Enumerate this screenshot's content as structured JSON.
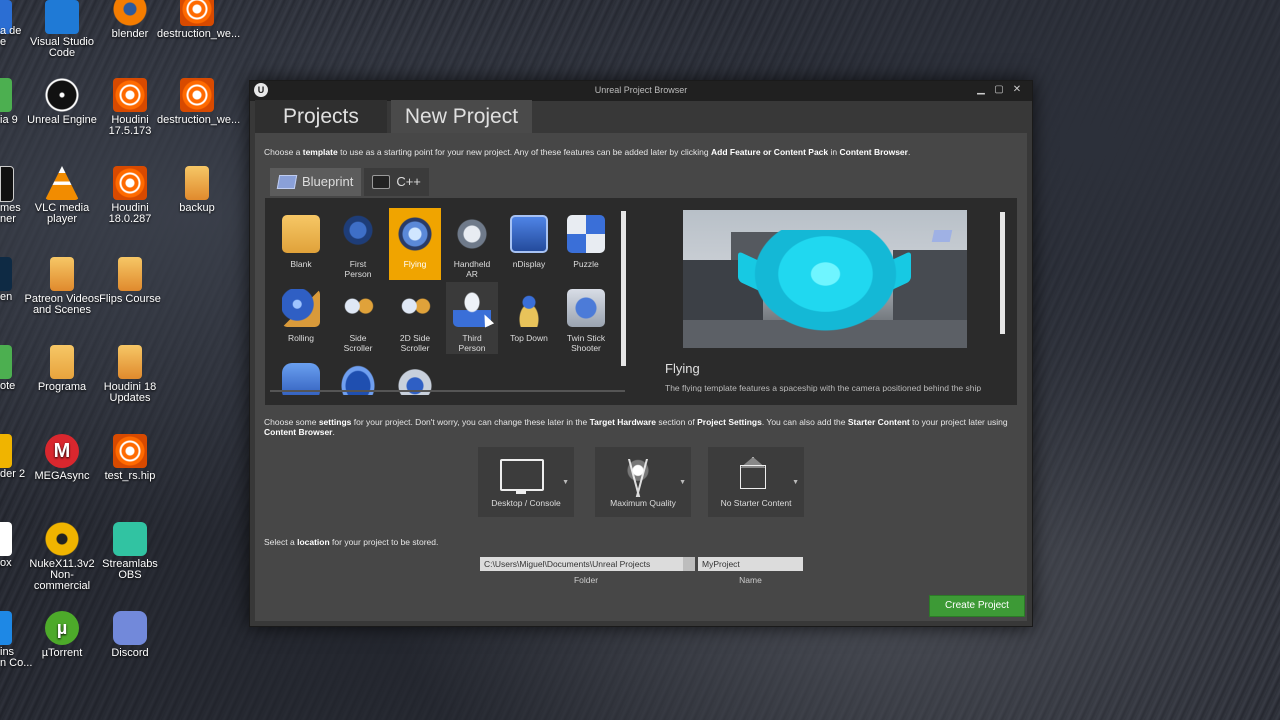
{
  "desktop": {
    "icons": [
      {
        "label": "Visual Studio\nCode",
        "icon": "vscode-icon",
        "color": "#1f7ad6"
      },
      {
        "label": "blender",
        "icon": "blender-icon",
        "color": "#f57d00"
      },
      {
        "label": "destruction_we...",
        "icon": "houdini-icon",
        "color": "#ff6a00"
      },
      {
        "label": "Unreal Engine",
        "icon": "unreal-engine-icon",
        "color": "#1b1b1b"
      },
      {
        "label": "Houdini 17.5.173",
        "icon": "houdini-icon",
        "color": "#ff6a00"
      },
      {
        "label": "destruction_we...",
        "icon": "houdini-icon",
        "color": "#ff6a00"
      },
      {
        "label": "VLC media player",
        "icon": "vlc-icon",
        "color": "#f28c00"
      },
      {
        "label": "Houdini 18.0.287",
        "icon": "houdini-icon",
        "color": "#ff6a00"
      },
      {
        "label": "backup",
        "icon": "folder-houdini-icon",
        "color": "#f2a93a"
      },
      {
        "label": "Patreon Videos\nand Scenes",
        "icon": "folder-houdini-icon",
        "color": "#f2a93a"
      },
      {
        "label": "Flips Course",
        "icon": "folder-houdini-icon",
        "color": "#f2a93a"
      },
      {
        "label": "Programa",
        "icon": "folder-icon",
        "color": "#f2b94a"
      },
      {
        "label": "Houdini 18\nUpdates",
        "icon": "folder-houdini-icon",
        "color": "#f2a93a"
      },
      {
        "label": "MEGAsync",
        "icon": "mega-icon",
        "color": "#d9272e"
      },
      {
        "label": "test_rs.hip",
        "icon": "houdini-icon",
        "color": "#ff6a00"
      },
      {
        "label": "NukeX11.3v2\nNon-commercial",
        "icon": "nuke-icon",
        "color": "#f0b400"
      },
      {
        "label": "Streamlabs OBS",
        "icon": "streamlabs-icon",
        "color": "#31c3a2"
      },
      {
        "label": "µTorrent",
        "icon": "utorrent-icon",
        "color": "#4daa2a"
      },
      {
        "label": "Discord",
        "icon": "discord-icon",
        "color": "#7289da"
      }
    ],
    "partial_labels": [
      "a de\ne",
      "ia 9",
      "mes\nner",
      "en",
      "ote",
      "der 2",
      "ox",
      "ins\nn Co..."
    ]
  },
  "window": {
    "title": "Unreal Project Browser",
    "controls": {
      "minimize": "▁",
      "maximize": "▢",
      "close": "✕"
    },
    "tabs": [
      {
        "label": "Projects",
        "active": false
      },
      {
        "label": "New Project",
        "active": true
      }
    ],
    "intro": {
      "p1": "Choose a ",
      "b1": "template",
      "p2": " to use as a starting point for your new project.  Any of these features can be added later by clicking ",
      "b2": "Add Feature or Content Pack",
      "p3": " in ",
      "b3": "Content Browser",
      "p4": "."
    },
    "subtabs": [
      {
        "label": "Blueprint",
        "active": true
      },
      {
        "label": "C++",
        "active": false
      }
    ],
    "templates": [
      {
        "label": "Blank",
        "icon": "blank-template-icon",
        "selected": false
      },
      {
        "label": "First\nPerson",
        "icon": "first-person-template-icon",
        "selected": false
      },
      {
        "label": "Flying",
        "icon": "flying-template-icon",
        "selected": true
      },
      {
        "label": "Handheld\nAR",
        "icon": "handheld-ar-template-icon",
        "selected": false
      },
      {
        "label": "nDisplay",
        "icon": "ndisplay-template-icon",
        "selected": false
      },
      {
        "label": "Puzzle",
        "icon": "puzzle-template-icon",
        "selected": false
      },
      {
        "label": "Rolling",
        "icon": "rolling-template-icon",
        "selected": false
      },
      {
        "label": "Side\nScroller",
        "icon": "side-scroller-template-icon",
        "selected": false
      },
      {
        "label": "2D Side\nScroller",
        "icon": "2d-side-scroller-template-icon",
        "selected": false
      },
      {
        "label": "Third\nPerson",
        "icon": "third-person-template-icon",
        "selected": false
      },
      {
        "label": "Top Down",
        "icon": "top-down-template-icon",
        "selected": false
      },
      {
        "label": "Twin Stick\nShooter",
        "icon": "twin-stick-shooter-template-icon",
        "selected": false
      },
      {
        "label": "",
        "icon": "vehicle-template-icon",
        "selected": false
      },
      {
        "label": "",
        "icon": "vr-template-icon",
        "selected": false
      },
      {
        "label": "",
        "icon": "vehicle-advanced-template-icon",
        "selected": false
      }
    ],
    "preview": {
      "title": "Flying",
      "description": "The flying template features a spaceship with the camera positioned behind the ship"
    },
    "settings_intro": {
      "p1": "Choose some ",
      "b1": "settings",
      "p2": " for your project.  Don't worry, you can change these later in the ",
      "b2": "Target Hardware",
      "p3": " section of ",
      "b3": "Project Settings",
      "p4": ".  You can also add the ",
      "b4": "Starter Content",
      "p5": " to your project later using ",
      "b5": "Content Browser",
      "p6": "."
    },
    "settings": [
      {
        "label": "Desktop / Console",
        "icon": "monitor-icon"
      },
      {
        "label": "Maximum Quality",
        "icon": "quality-plant-icon"
      },
      {
        "label": "No Starter Content",
        "icon": "box-icon"
      }
    ],
    "location": {
      "p1": "Select a ",
      "b1": "location",
      "p2": " for your project to be stored.",
      "folder_value": "C:\\Users\\Miguel\\Documents\\Unreal Projects",
      "folder_caption": "Folder",
      "name_value": "MyProject",
      "name_caption": "Name"
    },
    "create_button": "Create Project"
  }
}
